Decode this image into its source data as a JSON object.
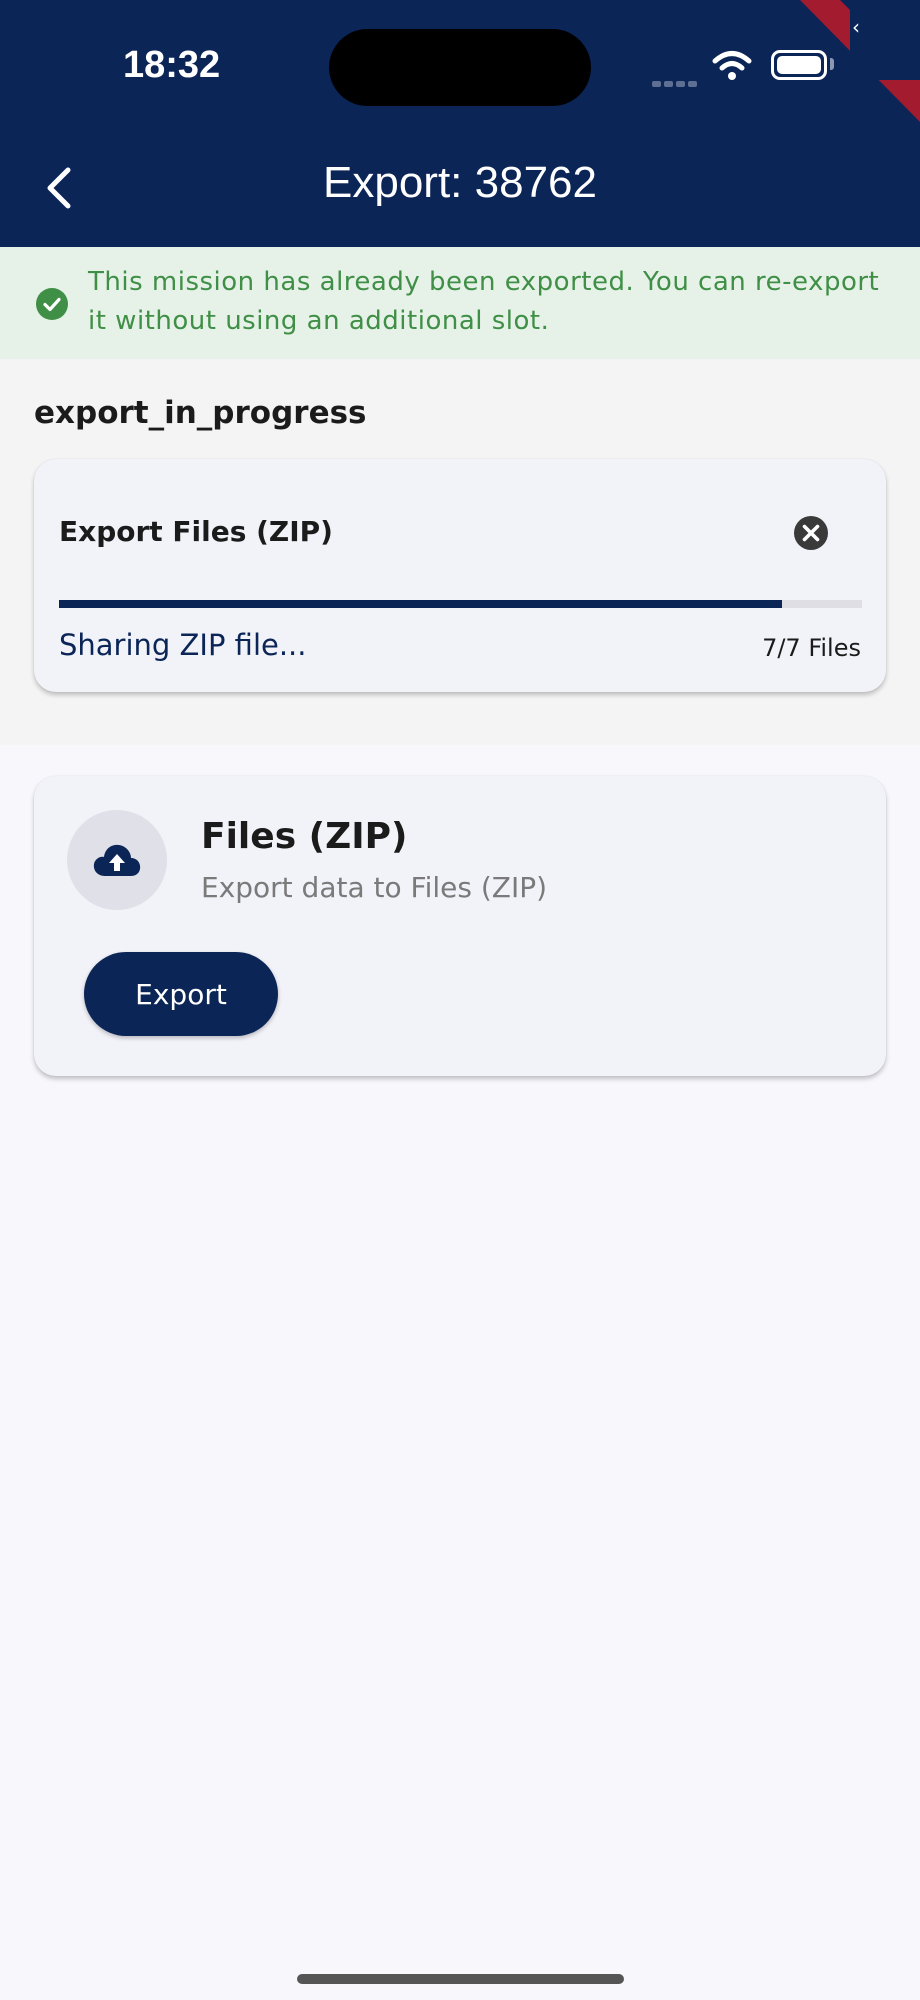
{
  "status_bar": {
    "time": "18:32"
  },
  "app_bar": {
    "title": "Export: 38762",
    "back_icon": "chevron-left-icon"
  },
  "notice": {
    "icon": "check-circle-icon",
    "text": "This mission has already been exported. You can re-export it without using an additional slot.",
    "color": "#3f8f46",
    "background": "#e6f1e8"
  },
  "progress_section": {
    "heading": "export_in_progress",
    "card": {
      "title": "Export Files (ZIP)",
      "cancel_icon": "close-circle-icon",
      "progress_fraction": 0.9,
      "status": "Sharing ZIP file...",
      "counter": "7/7 Files"
    }
  },
  "export_option": {
    "icon": "cloud-upload-icon",
    "title": "Files (ZIP)",
    "subtitle": "Export data to Files (ZIP)",
    "button_label": "Export"
  },
  "colors": {
    "primary": "#0b2557",
    "background": "#f7f7fc",
    "card": "#f2f2f9",
    "debug_banner": "#a31b2e"
  }
}
